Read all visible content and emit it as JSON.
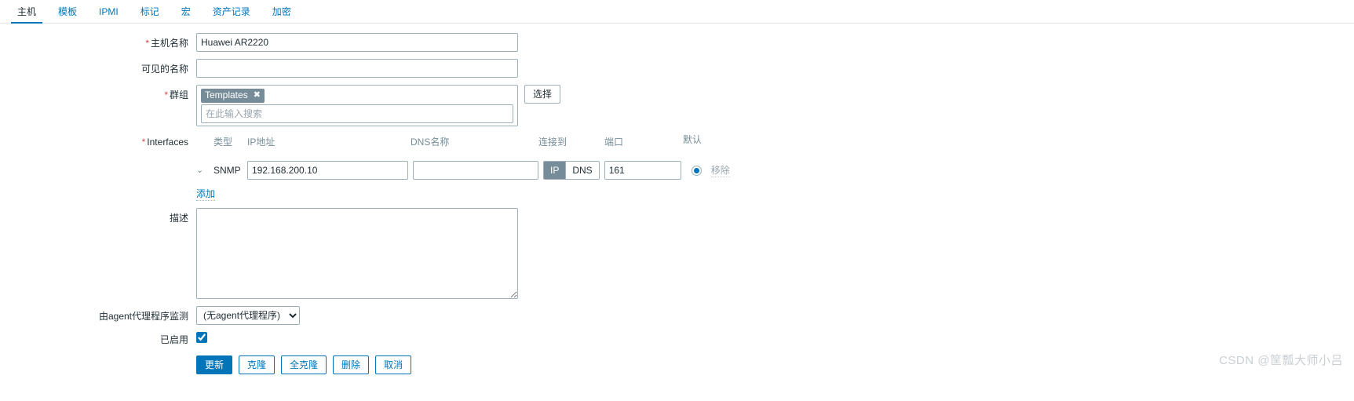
{
  "tabs": [
    {
      "label": "主机",
      "active": true
    },
    {
      "label": "模板",
      "active": false
    },
    {
      "label": "IPMI",
      "active": false
    },
    {
      "label": "标记",
      "active": false
    },
    {
      "label": "宏",
      "active": false
    },
    {
      "label": "资产记录",
      "active": false
    },
    {
      "label": "加密",
      "active": false
    }
  ],
  "form": {
    "host_name": {
      "label": "主机名称",
      "required": true,
      "value": "Huawei AR2220"
    },
    "visible_name": {
      "label": "可见的名称",
      "required": false,
      "value": "",
      "placeholder": ""
    },
    "groups": {
      "label": "群组",
      "required": true,
      "chips": [
        {
          "text": "Templates",
          "remove_glyph": "✖"
        }
      ],
      "placeholder": "在此输入搜索",
      "select_button": "选择"
    },
    "interfaces": {
      "label": "Interfaces",
      "required": true,
      "columns": {
        "type": "类型",
        "ip": "IP地址",
        "dns": "DNS名称",
        "connect_to": "连接到",
        "port": "端口",
        "default": "默认"
      },
      "rows": [
        {
          "expand_glyph": "⌄",
          "type": "SNMP",
          "ip": "192.168.200.10",
          "dns": "",
          "connect_ip": "IP",
          "connect_dns": "DNS",
          "connect_selected": "IP",
          "port": "161",
          "is_default": true,
          "remove_label": "移除"
        }
      ],
      "add_label": "添加"
    },
    "description": {
      "label": "描述",
      "value": ""
    },
    "proxy": {
      "label": "由agent代理程序监测",
      "selected": "(无agent代理程序)",
      "options": [
        "(无agent代理程序)"
      ]
    },
    "enabled": {
      "label": "已启用",
      "checked": true
    }
  },
  "buttons": {
    "update": "更新",
    "clone": "克隆",
    "full_clone": "全克隆",
    "delete": "删除",
    "cancel": "取消"
  },
  "watermark": "CSDN @筐瓢大师小吕",
  "colors": {
    "accent": "#0275b8",
    "required": "#dd4444",
    "chip_bg": "#768d99",
    "border": "#9cb0ba",
    "muted": "#768d99"
  }
}
